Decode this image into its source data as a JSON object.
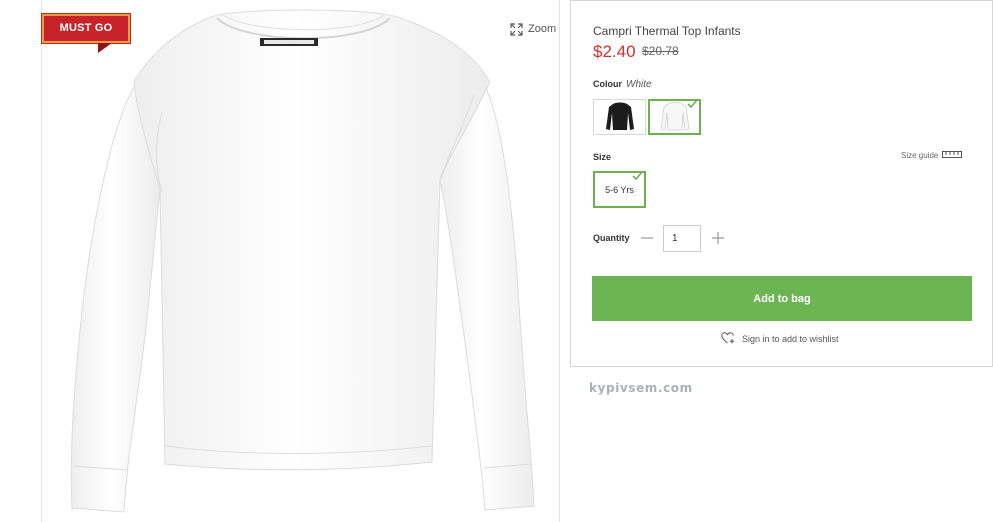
{
  "badge": {
    "label": "MUST GO",
    "color": "#c8222a"
  },
  "zoom": {
    "label": "Zoom",
    "icon": "expand-icon"
  },
  "product": {
    "title": "Campri Thermal Top Infants",
    "price_current": "$2.40",
    "price_old": "$20.78",
    "price_color": "#d0312d"
  },
  "colour": {
    "label": "Colour",
    "selected": "White",
    "options": [
      {
        "name": "Black",
        "selected": false
      },
      {
        "name": "White",
        "selected": true
      }
    ]
  },
  "size": {
    "label": "Size",
    "guide_label": "Size guide",
    "guide_icon": "ruler-icon",
    "options": [
      {
        "label": "5-6 Yrs",
        "selected": true
      }
    ]
  },
  "quantity": {
    "label": "Quantity",
    "value": "1"
  },
  "actions": {
    "add_to_bag": "Add to bag",
    "add_to_bag_color": "#6db553",
    "wishlist": "Sign in to add to wishlist",
    "wishlist_icon": "heart-plus-icon"
  },
  "watermark": {
    "text": "kypivsem.com"
  }
}
